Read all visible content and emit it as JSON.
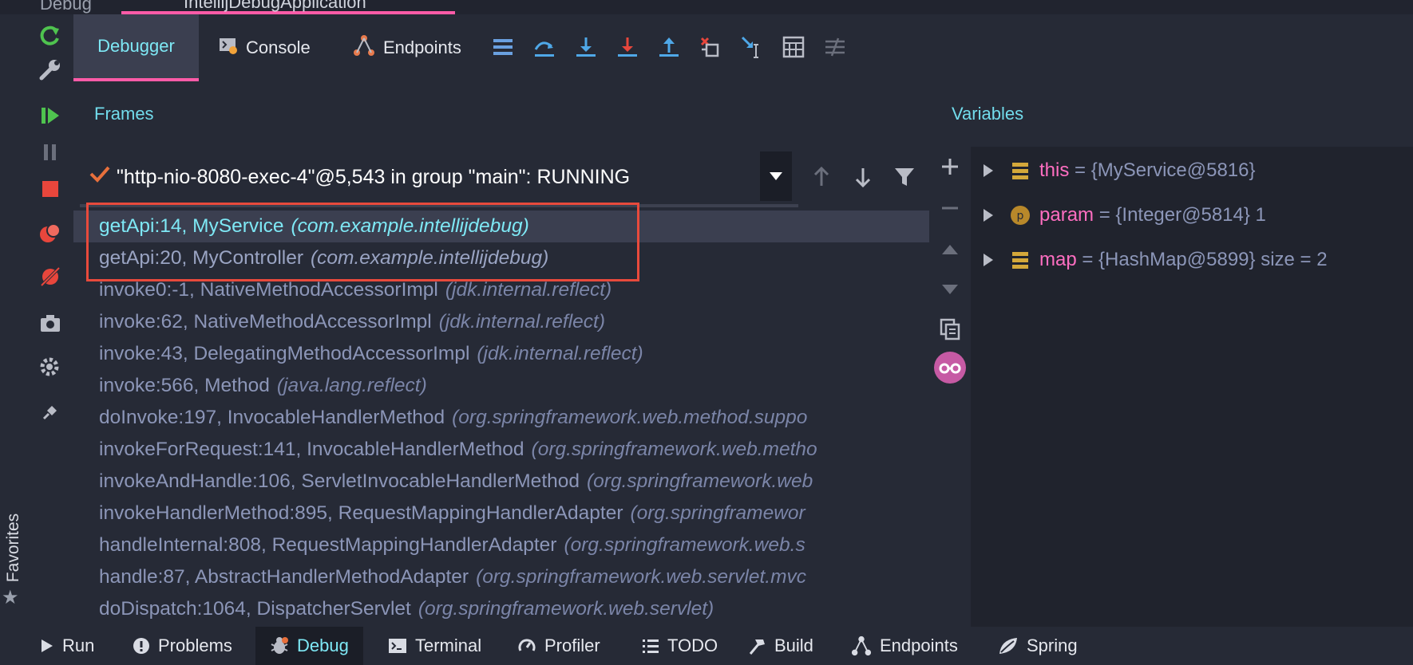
{
  "top_tabs": {
    "left_tab": "Debug",
    "active_tab": "IntellijDebugApplication"
  },
  "toolbar": {
    "tabs": [
      {
        "label": "Debugger",
        "icon": ""
      },
      {
        "label": "Console",
        "icon": "console-icon"
      },
      {
        "label": "Endpoints",
        "icon": "endpoints-icon"
      }
    ]
  },
  "frames": {
    "label": "Frames",
    "thread": "\"http-nio-8080-exec-4\"@5,543 in group \"main\": RUNNING",
    "rows": [
      {
        "method": "getApi:14, MyService",
        "pkg": "(com.example.intellijdebug)"
      },
      {
        "method": "getApi:20, MyController",
        "pkg": "(com.example.intellijdebug)"
      },
      {
        "method": "invoke0:-1, NativeMethodAccessorImpl",
        "pkg": "(jdk.internal.reflect)"
      },
      {
        "method": "invoke:62, NativeMethodAccessorImpl",
        "pkg": "(jdk.internal.reflect)"
      },
      {
        "method": "invoke:43, DelegatingMethodAccessorImpl",
        "pkg": "(jdk.internal.reflect)"
      },
      {
        "method": "invoke:566, Method",
        "pkg": "(java.lang.reflect)"
      },
      {
        "method": "doInvoke:197, InvocableHandlerMethod",
        "pkg": "(org.springframework.web.method.suppo"
      },
      {
        "method": "invokeForRequest:141, InvocableHandlerMethod",
        "pkg": "(org.springframework.web.metho"
      },
      {
        "method": "invokeAndHandle:106, ServletInvocableHandlerMethod",
        "pkg": "(org.springframework.web"
      },
      {
        "method": "invokeHandlerMethod:895, RequestMappingHandlerAdapter",
        "pkg": "(org.springframewor"
      },
      {
        "method": "handleInternal:808, RequestMappingHandlerAdapter",
        "pkg": "(org.springframework.web.s"
      },
      {
        "method": "handle:87, AbstractHandlerMethodAdapter",
        "pkg": "(org.springframework.web.servlet.mvc"
      },
      {
        "method": "doDispatch:1064, DispatcherServlet",
        "pkg": "(org.springframework.web.servlet)"
      }
    ]
  },
  "variables": {
    "label": "Variables",
    "rows": [
      {
        "name": "this",
        "value": " = {MyService@5816}",
        "icon": "field-icon"
      },
      {
        "name": "param",
        "value": " = {Integer@5814} 1",
        "icon": "param-icon"
      },
      {
        "name": "map",
        "value": " = {HashMap@5899}  size = 2",
        "icon": "field-icon"
      }
    ]
  },
  "favorites": {
    "label": "Favorites"
  },
  "bottombar": {
    "items": [
      {
        "label": "Run",
        "icon": "run-icon"
      },
      {
        "label": "Problems",
        "icon": "problems-icon"
      },
      {
        "label": "Debug",
        "icon": "debug-icon"
      },
      {
        "label": "Terminal",
        "icon": "terminal-icon"
      },
      {
        "label": "Profiler",
        "icon": "profiler-icon"
      },
      {
        "label": "TODO",
        "icon": "todo-icon"
      },
      {
        "label": "Build",
        "icon": "build-icon"
      },
      {
        "label": "Endpoints",
        "icon": "endpoints-icon"
      },
      {
        "label": "Spring",
        "icon": "spring-icon"
      }
    ]
  },
  "colors": {
    "accent_pink": "#ff5ba8",
    "accent_cyan": "#72dcec",
    "highlight_red": "#e84a3c",
    "background": "#262a36"
  }
}
